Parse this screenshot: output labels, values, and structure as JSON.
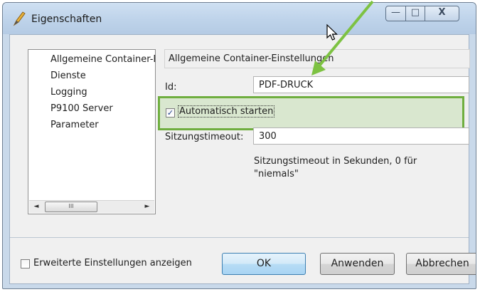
{
  "window": {
    "title": "Eigenschaften",
    "minimize_glyph": "—",
    "maximize_glyph": "□",
    "close_glyph": "X"
  },
  "tree": {
    "items": [
      {
        "label": "Allgemeine Container-Einstellungen"
      },
      {
        "label": "Dienste"
      },
      {
        "label": "Logging"
      },
      {
        "label": "P9100 Server"
      },
      {
        "label": "Parameter"
      }
    ],
    "scroll_left": "◄",
    "scroll_right": "►",
    "thumb_grip": "III"
  },
  "panel": {
    "header": "Allgemeine Container-Einstellungen",
    "id_label": "Id:",
    "id_value": "PDF-DRUCK",
    "autostart_label": "Automatisch starten",
    "autostart_checked": true,
    "timeout_label": "Sitzungstimeout:",
    "timeout_value": "300",
    "timeout_hint": "Sitzungstimeout in Sekunden, 0 für \"niemals\""
  },
  "footer": {
    "advanced_label": "Erweiterte Einstellungen anzeigen",
    "advanced_checked": false,
    "ok_label": "OK",
    "apply_label": "Anwenden",
    "cancel_label": "Abbrechen"
  },
  "colors": {
    "highlight_border": "#6fae3f",
    "arrow": "#7dc242"
  }
}
